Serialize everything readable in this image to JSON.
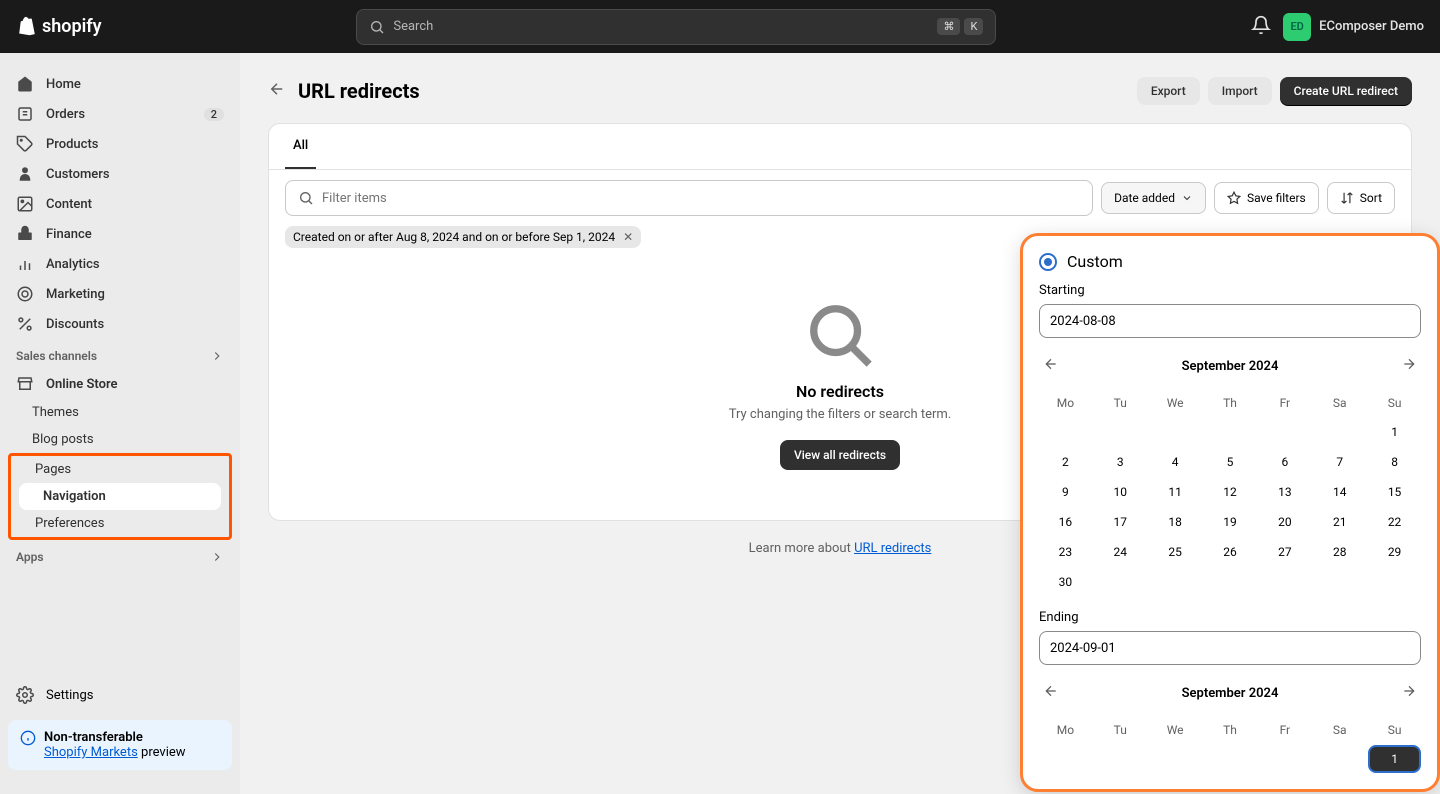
{
  "topbar": {
    "brand": "shopify",
    "searchPlaceholder": "Search",
    "kbd1": "⌘",
    "kbd2": "K",
    "avatarInitials": "ED",
    "profileName": "EComposer Demo"
  },
  "sidebar": {
    "items": [
      {
        "label": "Home"
      },
      {
        "label": "Orders",
        "badge": "2"
      },
      {
        "label": "Products"
      },
      {
        "label": "Customers"
      },
      {
        "label": "Content"
      },
      {
        "label": "Finance"
      },
      {
        "label": "Analytics"
      },
      {
        "label": "Marketing"
      },
      {
        "label": "Discounts"
      }
    ],
    "salesChannels": "Sales channels",
    "onlineStore": "Online Store",
    "subItems": [
      {
        "label": "Themes"
      },
      {
        "label": "Blog posts"
      },
      {
        "label": "Pages"
      },
      {
        "label": "Navigation"
      },
      {
        "label": "Preferences"
      }
    ],
    "apps": "Apps",
    "settings": "Settings",
    "noticeTitle": "Non-transferable",
    "noticeLink": "Shopify Markets",
    "noticeSuffix": " preview"
  },
  "page": {
    "title": "URL redirects",
    "export": "Export",
    "import": "Import",
    "create": "Create URL redirect",
    "tabAll": "All",
    "filterPlaceholder": "Filter items",
    "dateAdded": "Date added",
    "saveFilters": "Save filters",
    "sort": "Sort",
    "chip": "Created on or after Aug 8, 2024 and on or before Sep 1, 2024",
    "emptyTitle": "No redirects",
    "emptyText": "Try changing the filters or search term.",
    "viewAll": "View all redirects",
    "learnPrefix": "Learn more about ",
    "learnLink": "URL redirects"
  },
  "popover": {
    "customLabel": "Custom",
    "startingLabel": "Starting",
    "startingValue": "2024-08-08",
    "endingLabel": "Ending",
    "endingValue": "2024-09-01",
    "month1": "September 2024",
    "month2": "September 2024",
    "weekdays": [
      "Mo",
      "Tu",
      "We",
      "Th",
      "Fr",
      "Sa",
      "Su"
    ],
    "cal1": [
      [
        "",
        "",
        "",
        "",
        "",
        "",
        "1"
      ],
      [
        "2",
        "3",
        "4",
        "5",
        "6",
        "7",
        "8"
      ],
      [
        "9",
        "10",
        "11",
        "12",
        "13",
        "14",
        "15"
      ],
      [
        "16",
        "17",
        "18",
        "19",
        "20",
        "21",
        "22"
      ],
      [
        "23",
        "24",
        "25",
        "26",
        "27",
        "28",
        "29"
      ],
      [
        "30",
        "",
        "",
        "",
        "",
        "",
        ""
      ]
    ],
    "cal2Selected": "1"
  }
}
